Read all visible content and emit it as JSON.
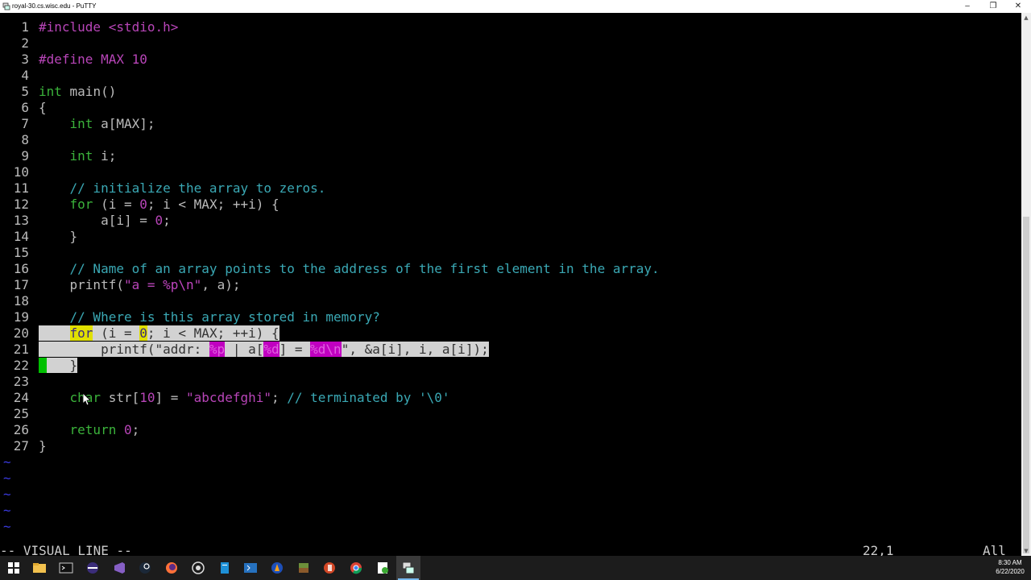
{
  "window": {
    "title": "royal-30.cs.wisc.edu - PuTTY"
  },
  "editor": {
    "lines": [
      {
        "n": "1",
        "segs": [
          {
            "t": "#include",
            "c": "pp"
          },
          {
            "t": " <stdio.h>",
            "c": "st"
          }
        ]
      },
      {
        "n": "2",
        "segs": []
      },
      {
        "n": "3",
        "segs": [
          {
            "t": "#define MAX 10",
            "c": "pp"
          }
        ]
      },
      {
        "n": "4",
        "segs": []
      },
      {
        "n": "5",
        "segs": [
          {
            "t": "int",
            "c": "ty"
          },
          {
            "t": " main()",
            "c": ""
          }
        ]
      },
      {
        "n": "6",
        "segs": [
          {
            "t": "{",
            "c": ""
          }
        ]
      },
      {
        "n": "7",
        "segs": [
          {
            "t": "    ",
            "c": ""
          },
          {
            "t": "int",
            "c": "ty"
          },
          {
            "t": " a[MAX];",
            "c": ""
          }
        ]
      },
      {
        "n": "8",
        "segs": []
      },
      {
        "n": "9",
        "segs": [
          {
            "t": "    ",
            "c": ""
          },
          {
            "t": "int",
            "c": "ty"
          },
          {
            "t": " i;",
            "c": ""
          }
        ]
      },
      {
        "n": "10",
        "segs": []
      },
      {
        "n": "11",
        "segs": [
          {
            "t": "    ",
            "c": ""
          },
          {
            "t": "// initialize the array to zeros.",
            "c": "cm"
          }
        ]
      },
      {
        "n": "12",
        "segs": [
          {
            "t": "    ",
            "c": ""
          },
          {
            "t": "for",
            "c": "ty"
          },
          {
            "t": " (i = ",
            "c": ""
          },
          {
            "t": "0",
            "c": "nm"
          },
          {
            "t": "; i < MAX; ++i) {",
            "c": ""
          }
        ]
      },
      {
        "n": "13",
        "segs": [
          {
            "t": "        a[i] = ",
            "c": ""
          },
          {
            "t": "0",
            "c": "nm"
          },
          {
            "t": ";",
            "c": ""
          }
        ]
      },
      {
        "n": "14",
        "segs": [
          {
            "t": "    }",
            "c": ""
          }
        ]
      },
      {
        "n": "15",
        "segs": []
      },
      {
        "n": "16",
        "segs": [
          {
            "t": "    ",
            "c": ""
          },
          {
            "t": "// Name of an array points to the address of the first element in the array.",
            "c": "cm"
          }
        ]
      },
      {
        "n": "17",
        "segs": [
          {
            "t": "    printf(",
            "c": ""
          },
          {
            "t": "\"a = ",
            "c": "st"
          },
          {
            "t": "%p\\n",
            "c": "fmt"
          },
          {
            "t": "\"",
            "c": "st"
          },
          {
            "t": ", a);",
            "c": ""
          }
        ]
      },
      {
        "n": "18",
        "segs": []
      },
      {
        "n": "19",
        "segs": [
          {
            "t": "    ",
            "c": ""
          },
          {
            "t": "// Where is this array stored in memory?",
            "c": "cm"
          }
        ]
      },
      {
        "n": "20",
        "segs": [
          {
            "t": "    ",
            "c": "sel"
          },
          {
            "t": "for",
            "c": "srch"
          },
          {
            "t": " (i = ",
            "c": "sel"
          },
          {
            "t": "0",
            "c": "srch"
          },
          {
            "t": "; i < MAX; ++i) {",
            "c": "sel"
          }
        ]
      },
      {
        "n": "21",
        "segs": [
          {
            "t": "        printf(\"addr: ",
            "c": "sel"
          },
          {
            "t": "%p",
            "c": "selfmt"
          },
          {
            "t": " | a[",
            "c": "sel"
          },
          {
            "t": "%d",
            "c": "selfmt"
          },
          {
            "t": "] = ",
            "c": "sel"
          },
          {
            "t": "%d\\n",
            "c": "selfmt"
          },
          {
            "t": "\", &a[i], i, a[i]);",
            "c": "sel"
          }
        ]
      },
      {
        "n": "22",
        "segs": [
          {
            "t": " ",
            "c": "cursor"
          },
          {
            "t": "   }",
            "c": "sel"
          }
        ]
      },
      {
        "n": "23",
        "segs": []
      },
      {
        "n": "24",
        "segs": [
          {
            "t": "    ",
            "c": ""
          },
          {
            "t": "char",
            "c": "ty"
          },
          {
            "t": " str[",
            "c": ""
          },
          {
            "t": "10",
            "c": "nm"
          },
          {
            "t": "] = ",
            "c": ""
          },
          {
            "t": "\"abcdefghi\"",
            "c": "st"
          },
          {
            "t": "; ",
            "c": ""
          },
          {
            "t": "// terminated by '\\0'",
            "c": "cm"
          }
        ]
      },
      {
        "n": "25",
        "segs": []
      },
      {
        "n": "26",
        "segs": [
          {
            "t": "    ",
            "c": ""
          },
          {
            "t": "return",
            "c": "ty"
          },
          {
            "t": " ",
            "c": ""
          },
          {
            "t": "0",
            "c": "nm"
          },
          {
            "t": ";",
            "c": ""
          }
        ]
      },
      {
        "n": "27",
        "segs": [
          {
            "t": "}",
            "c": ""
          }
        ]
      }
    ],
    "tilde_lines": [
      "~",
      "~",
      "~",
      "~",
      "~"
    ]
  },
  "status": {
    "mode": "-- VISUAL LINE --",
    "position": "22,1",
    "scroll": "All"
  },
  "taskbar": {
    "icons": [
      "windows-start-icon",
      "file-explorer-icon",
      "terminal-icon",
      "eclipse-icon",
      "visual-studio-icon",
      "steam-icon",
      "firefox-icon",
      "chrome-icon",
      "notepad-icon",
      "powershell-icon",
      "vlc-icon",
      "minecraft-icon",
      "powerpoint-icon",
      "google-chrome-icon",
      "notepadpp-icon",
      "putty-icon"
    ],
    "time": "8:30 AM",
    "date": "6/22/2020"
  },
  "colors": {
    "preprocessor": "#b845b8",
    "type": "#3bb33b",
    "comment": "#3aa8b4",
    "selection": "#d2d2d2",
    "search_highlight": "#e0e000",
    "cursor": "#00c000"
  }
}
